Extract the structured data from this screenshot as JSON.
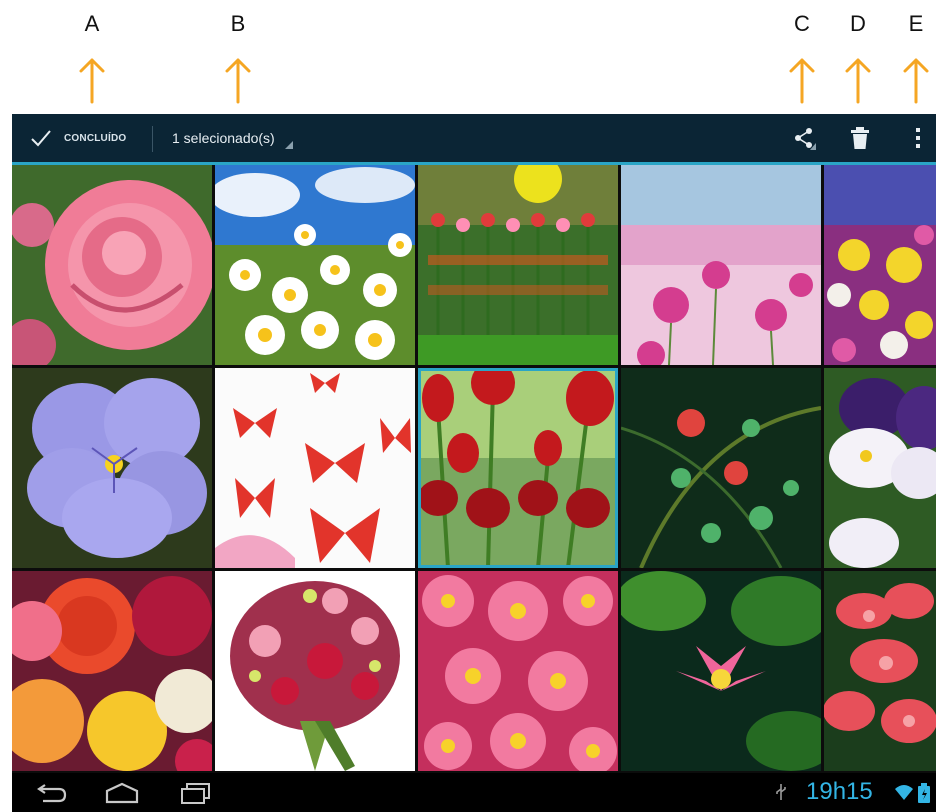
{
  "annotations": [
    {
      "letter": "A",
      "target": "done-button"
    },
    {
      "letter": "B",
      "target": "selection-dropdown"
    },
    {
      "letter": "C",
      "target": "share-button"
    },
    {
      "letter": "D",
      "target": "delete-button"
    },
    {
      "letter": "E",
      "target": "overflow-menu"
    }
  ],
  "actionbar": {
    "done_label": "CONCLUÍDO",
    "selection_label": "1 selecionado(s)",
    "icons": [
      "check-icon",
      "dropdown-triangle-icon",
      "share-icon",
      "trash-icon",
      "overflow-menu-icon"
    ]
  },
  "gallery": {
    "rows": 3,
    "columns": 5,
    "selected_index": 7,
    "thumbnails": [
      "pink-rose",
      "white-daisies-sky",
      "heart-flower-field",
      "pink-cosmos-field",
      "multicolor-flowerbed",
      "purple-pansy",
      "red-butterflies-pattern",
      "red-tulips",
      "red-flowers-green-fractal",
      "purple-white-pansies",
      "colorful-roses",
      "flower-bouquet",
      "pink-gerbera-daisies",
      "pink-water-lily",
      "red-plumeria"
    ]
  },
  "navbar": {
    "icons": [
      "back-icon",
      "home-icon",
      "recent-apps-icon"
    ]
  },
  "statusbar": {
    "time": "19h15",
    "icons": [
      "usb-icon",
      "wifi-icon",
      "battery-icon"
    ]
  },
  "colors": {
    "actionbar_bg": "#0b2535",
    "accent": "#2aa5c6",
    "clock": "#33b5e5",
    "annotation_arrow": "#f5a623"
  }
}
